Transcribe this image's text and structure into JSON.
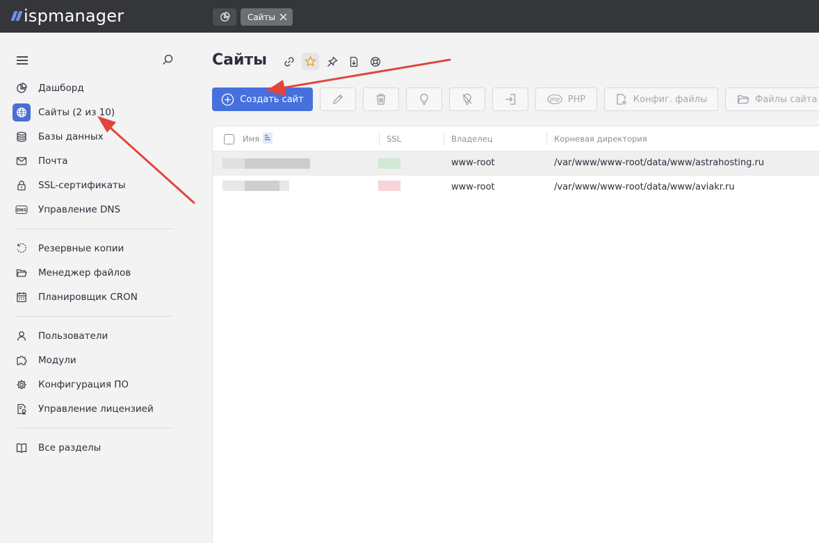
{
  "app": {
    "logo_text": "ispmanager",
    "brand_color": "#6d8ff3"
  },
  "topbar": {
    "tabs": [
      {
        "label": "Сайты",
        "close_icon": "close-icon"
      }
    ],
    "dashboard_icon": "pie-chart-icon"
  },
  "sidebar": {
    "groups": [
      [
        {
          "label": "Дашборд",
          "icon": "pie-chart-icon"
        },
        {
          "label": "Сайты (2 из 10)",
          "icon": "globe-icon",
          "active": true
        },
        {
          "label": "Базы данных",
          "icon": "database-icon"
        },
        {
          "label": "Почта",
          "icon": "mail-icon"
        },
        {
          "label": "SSL-сертификаты",
          "icon": "lock-icon"
        },
        {
          "label": "Управление DNS",
          "icon": "dns-icon"
        }
      ],
      [
        {
          "label": "Резервные копии",
          "icon": "backup-icon"
        },
        {
          "label": "Менеджер файлов",
          "icon": "folder-icon"
        },
        {
          "label": "Планировщик CRON",
          "icon": "calendar-icon"
        }
      ],
      [
        {
          "label": "Пользователи",
          "icon": "user-icon"
        },
        {
          "label": "Модули",
          "icon": "puzzle-icon"
        },
        {
          "label": "Конфигурация ПО",
          "icon": "gear-icon"
        },
        {
          "label": "Управление лицензией",
          "icon": "license-icon"
        }
      ],
      [
        {
          "label": "Все разделы",
          "icon": "book-icon"
        }
      ]
    ]
  },
  "page": {
    "title": "Сайты",
    "title_icons": [
      "link-icon",
      "star-icon",
      "pin-icon",
      "export-icon",
      "help-icon"
    ]
  },
  "toolbar": {
    "create_label": "Создать сайт",
    "php_label": "PHP",
    "config_label": "Конфиг. файлы",
    "files_label": "Файлы сайта"
  },
  "table": {
    "columns": [
      "Имя",
      "SSL",
      "Владелец",
      "Корневая директория"
    ],
    "rows": [
      {
        "owner": "www-root",
        "root_dir": "/var/www/www-root/data/www/astrahosting.ru",
        "ssl_status_color": "#cfe9d5"
      },
      {
        "owner": "www-root",
        "root_dir": "/var/www/www-root/data/www/aviakr.ru",
        "ssl_status_color": "#f7d4d8"
      }
    ]
  },
  "accent_color": "#4670dd",
  "annotation_color": "#e2453b"
}
